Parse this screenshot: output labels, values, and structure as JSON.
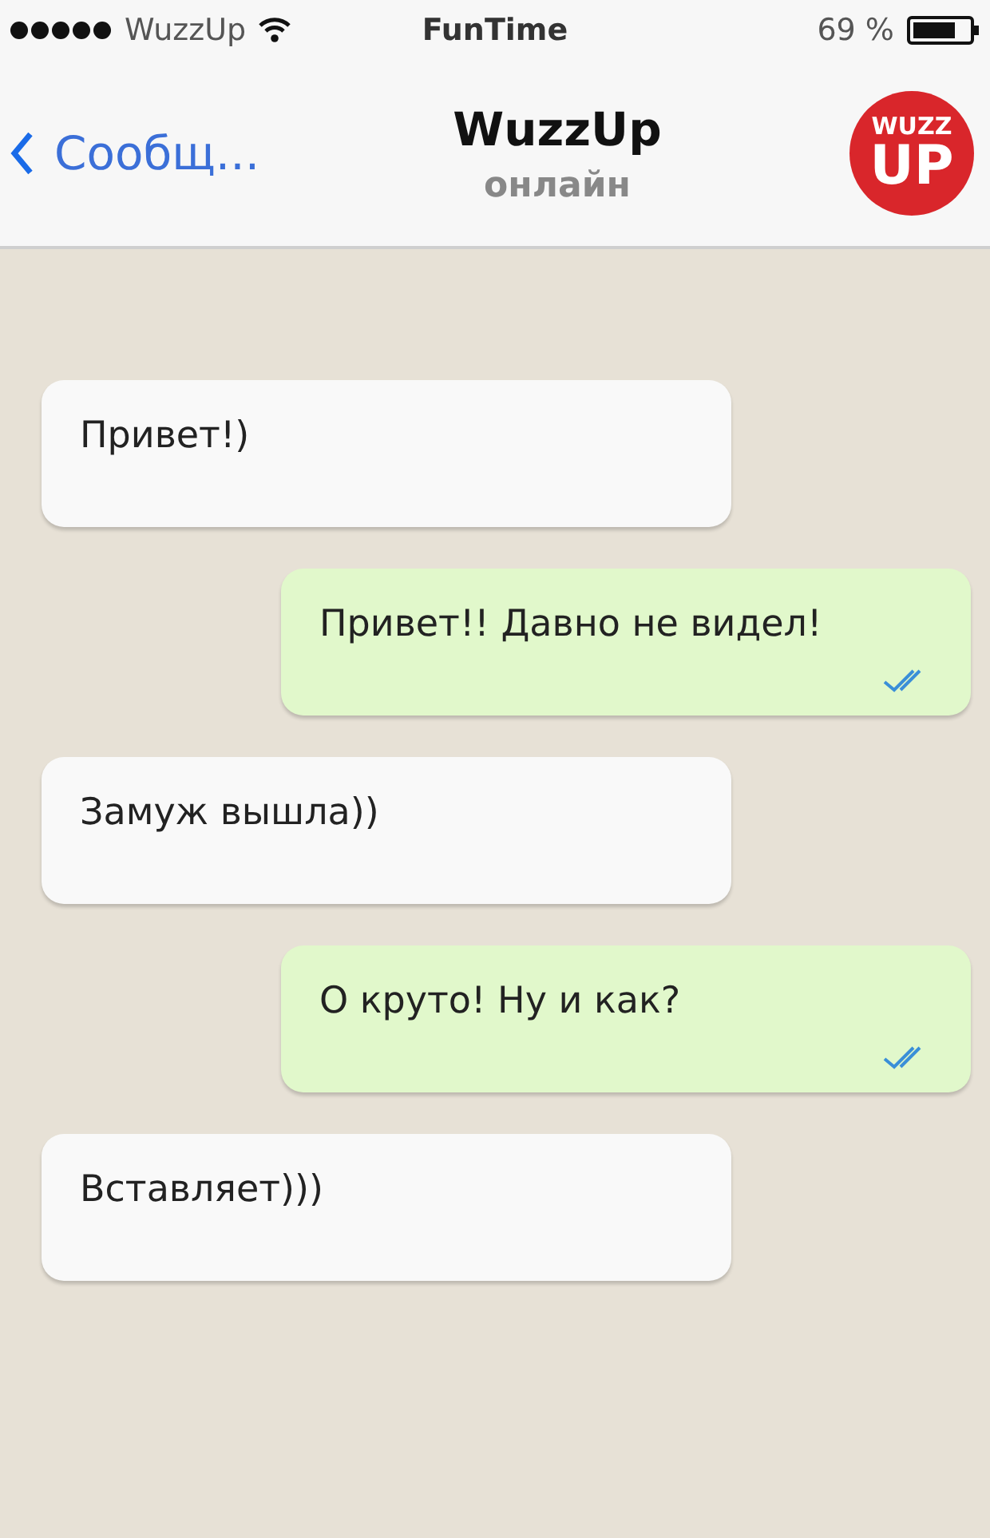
{
  "status_bar": {
    "carrier": "WuzzUp",
    "time": "FunTime",
    "battery": "69 %"
  },
  "nav": {
    "back": "Сообщ...",
    "title": "WuzzUp",
    "subtitle": "онлайн",
    "logo": [
      "WUZZ",
      "UP"
    ]
  },
  "messages": [
    {
      "kind": "incoming",
      "text": "Привет!)"
    },
    {
      "kind": "outgoing",
      "text": "Привет!! Давно не видел!"
    },
    {
      "kind": "incoming",
      "text": "Замуж вышла))"
    },
    {
      "kind": "outgoing",
      "text": "О круто! Ну и как?"
    },
    {
      "kind": "incoming",
      "text": "Вставляет)))"
    }
  ]
}
